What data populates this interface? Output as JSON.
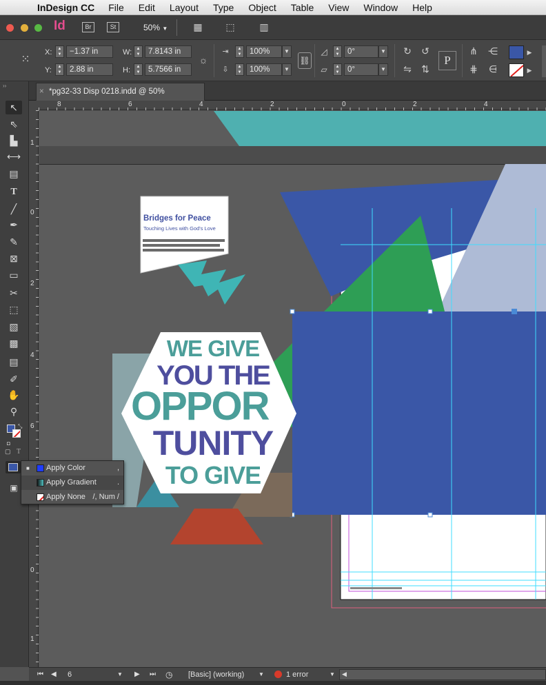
{
  "menubar": {
    "app": "InDesign CC",
    "items": [
      "File",
      "Edit",
      "Layout",
      "Type",
      "Object",
      "Table",
      "View",
      "Window",
      "Help"
    ]
  },
  "appbar": {
    "id_logo": "Id",
    "br": "Br",
    "st": "St",
    "zoom": "50%"
  },
  "control": {
    "x_label": "X:",
    "x_value": "−1.37 in",
    "y_label": "Y:",
    "y_value": "2.88 in",
    "w_label": "W:",
    "w_value": "7.8143 in",
    "h_label": "H:",
    "h_value": "5.7566 in",
    "scale_x": "100%",
    "scale_y": "100%",
    "rotation": "0°",
    "shear": "0°",
    "p_glyph": "P",
    "fill_color": "#3a57a7"
  },
  "tab": {
    "close": "×",
    "title": "*pg32-33 Disp 0218.indd @ 50%"
  },
  "hruler": {
    "labels": [
      "8",
      "6",
      "4",
      "2",
      "0",
      "2",
      "4"
    ]
  },
  "vruler": {
    "labels": [
      "1",
      "0",
      "2",
      "4",
      "6",
      "8",
      "0",
      "1"
    ]
  },
  "artwork": {
    "logo_title": "Bridges for Peace",
    "logo_tagline": "Touching Lives with God's Love",
    "headline": [
      "WE GIVE",
      "YOU THE",
      "OPPOR",
      "TUNITY",
      "TO GIVE"
    ]
  },
  "popup": {
    "items": [
      {
        "label": "Apply Color",
        "key": ",",
        "swatch": "#1e3cff"
      },
      {
        "label": "Apply Gradient",
        "key": ".",
        "swatch": "gradient"
      },
      {
        "label": "Apply None",
        "key": "/, Num /",
        "swatch": "none"
      }
    ]
  },
  "status": {
    "page": "6",
    "style": "[Basic] (working)",
    "errors": "1 error"
  },
  "colors": {
    "teal": "#4fb0b0",
    "blue": "#3a57a7",
    "green": "#2e9e55",
    "lightblue": "#aebbd6",
    "headline_purple": "#4e4e9e",
    "headline_teal": "#4b9e99"
  }
}
